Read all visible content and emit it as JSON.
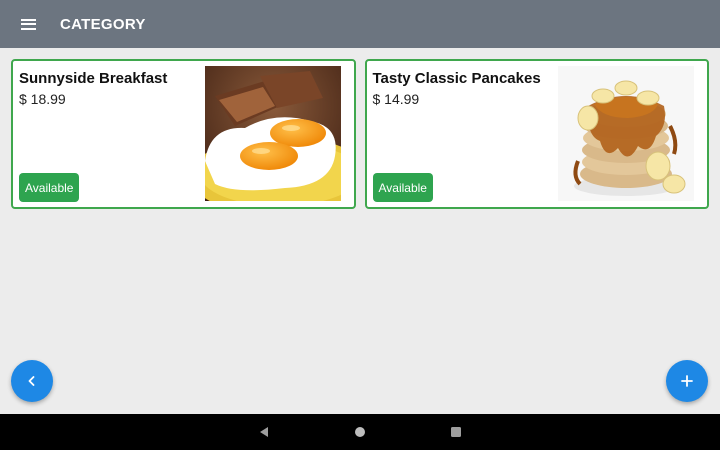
{
  "app": {
    "title": "CATEGORY",
    "appbar_color": "#6c7580",
    "accent_color": "#1e88e5"
  },
  "items": [
    {
      "name": "Sunnyside Breakfast",
      "price": "$ 18.99",
      "status": "Available",
      "image_icon": "fried-eggs-toast-photo"
    },
    {
      "name": "Tasty Classic Pancakes",
      "price": "$ 14.99",
      "status": "Available",
      "image_icon": "banana-pancakes-photo"
    }
  ],
  "fabs": {
    "back_icon": "chevron-left-icon",
    "add_icon": "plus-icon"
  },
  "system_nav": {
    "back_icon": "triangle-back-icon",
    "home_icon": "circle-home-icon",
    "recent_icon": "square-recents-icon"
  }
}
